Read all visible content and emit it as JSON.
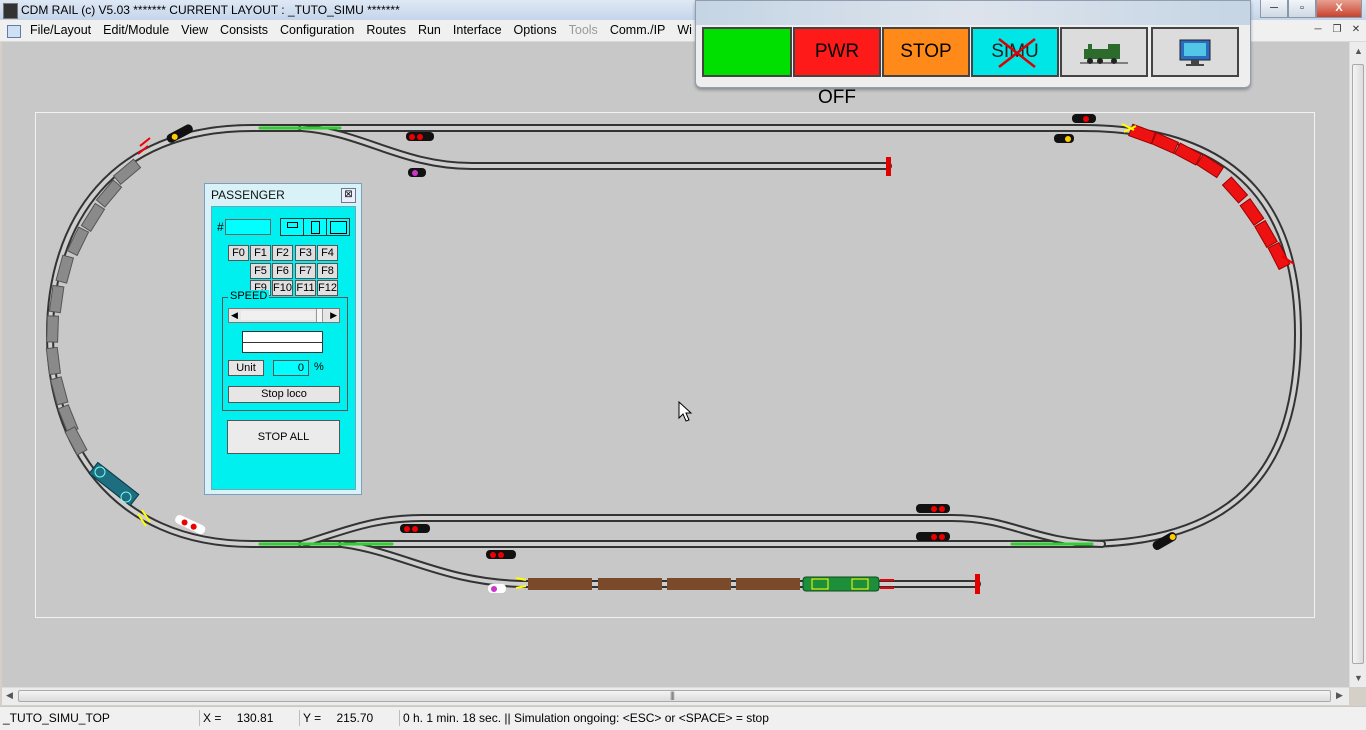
{
  "window": {
    "title": "CDM RAIL (c) V5.03     ******* CURRENT LAYOUT : _TUTO_SIMU *******",
    "min_label": "─",
    "max_label": "▫",
    "close_label": "X"
  },
  "menu": {
    "items": [
      {
        "label": "File/Layout"
      },
      {
        "label": "Edit/Module"
      },
      {
        "label": "View"
      },
      {
        "label": "Consists"
      },
      {
        "label": "Configuration"
      },
      {
        "label": "Routes"
      },
      {
        "label": "Run"
      },
      {
        "label": "Interface"
      },
      {
        "label": "Options"
      },
      {
        "label": "Tools"
      },
      {
        "label": "Comm./IP"
      },
      {
        "label": "Wi"
      }
    ],
    "mdi_min": "─",
    "mdi_restore": "❐",
    "mdi_close": "✕"
  },
  "toolbar": {
    "pwr_off": "PWR OFF",
    "stop": "STOP",
    "simu": "SIMU",
    "colors": {
      "power_on": "#00e000",
      "pwr_off": "#ff0000",
      "stop": "#ff8000",
      "simu": "#00e0e0"
    },
    "loco_icon": "steam-loco-icon",
    "monitor_icon": "monitor-icon"
  },
  "panel": {
    "title": "PASSENGER",
    "address_hash": "#",
    "address_value": "",
    "function_keys": [
      "F0",
      "F1",
      "F2",
      "F3",
      "F4",
      "F5",
      "F6",
      "F7",
      "F8",
      "F9",
      "F10",
      "F11",
      "F12"
    ],
    "speed_title": "SPEED",
    "unit_label": "Unit",
    "speed_value": "0",
    "percent": "%",
    "stop_loco": "Stop loco",
    "stop_all": "STOP ALL"
  },
  "status": {
    "layout": "_TUTO_SIMU_TOP",
    "x_label": "X =",
    "x_value": "130.81",
    "y_label": "Y =",
    "y_value": "215.70",
    "message": "0 h. 1 min. 18 sec.  || Simulation ongoing: <ESC> or <SPACE> = stop"
  }
}
